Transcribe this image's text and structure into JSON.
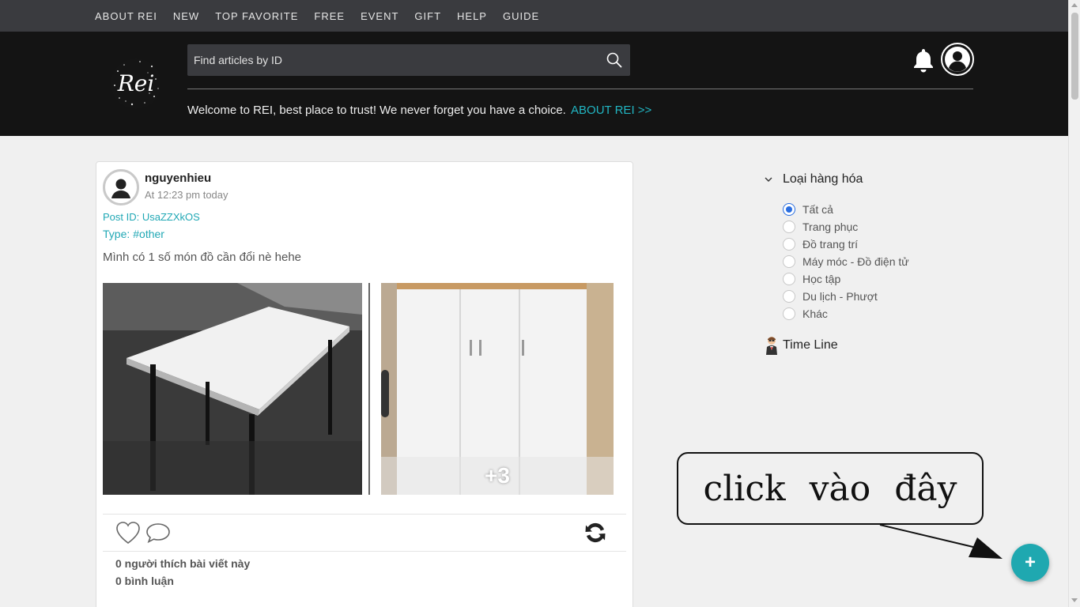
{
  "nav": {
    "items": [
      "ABOUT REI",
      "NEW",
      "TOP FAVORITE",
      "FREE",
      "EVENT",
      "GIFT",
      "HELP",
      "GUIDE"
    ]
  },
  "header": {
    "logo_text": "Rei",
    "search_placeholder": "Find articles by ID",
    "search_icon": "search-icon",
    "bell_icon": "bell-icon",
    "account_icon": "user-circle-icon",
    "welcome_text": "Welcome to REI, best place to trust! We never forget you have a choice.",
    "welcome_link": "ABOUT REI >>"
  },
  "post": {
    "username": "nguyenhieu",
    "time": "At 12:23 pm today",
    "post_id": "Post ID: UsaZZXkOS",
    "type_label": "Type:",
    "type_value": "#other",
    "content": "Mình có 1 số món đồ cần đổi nè hehe",
    "more_images": "+3",
    "likes_text": "0 người thích bài viết này",
    "comments_text": "0 bình luận",
    "icons": [
      "heart-icon",
      "comment-icon",
      "refresh-icon"
    ]
  },
  "sidebar": {
    "filter_title": "Loại hàng hóa",
    "filter_options": [
      "Tất cả",
      "Trang phục",
      "Đồ trang trí",
      "Máy móc - Đồ điện tử",
      "Học tập",
      "Du lịch - Phượt",
      "Khác"
    ],
    "selected_option": "Tất cả",
    "timeline_label": "Time Line"
  },
  "callout": {
    "text": "click vào đây"
  },
  "fab": {
    "label": "+"
  },
  "colors": {
    "accent": "#1fa8b0",
    "link": "#21b5c2",
    "header_bg": "#141414",
    "nav_bg": "#3a3b3f"
  }
}
